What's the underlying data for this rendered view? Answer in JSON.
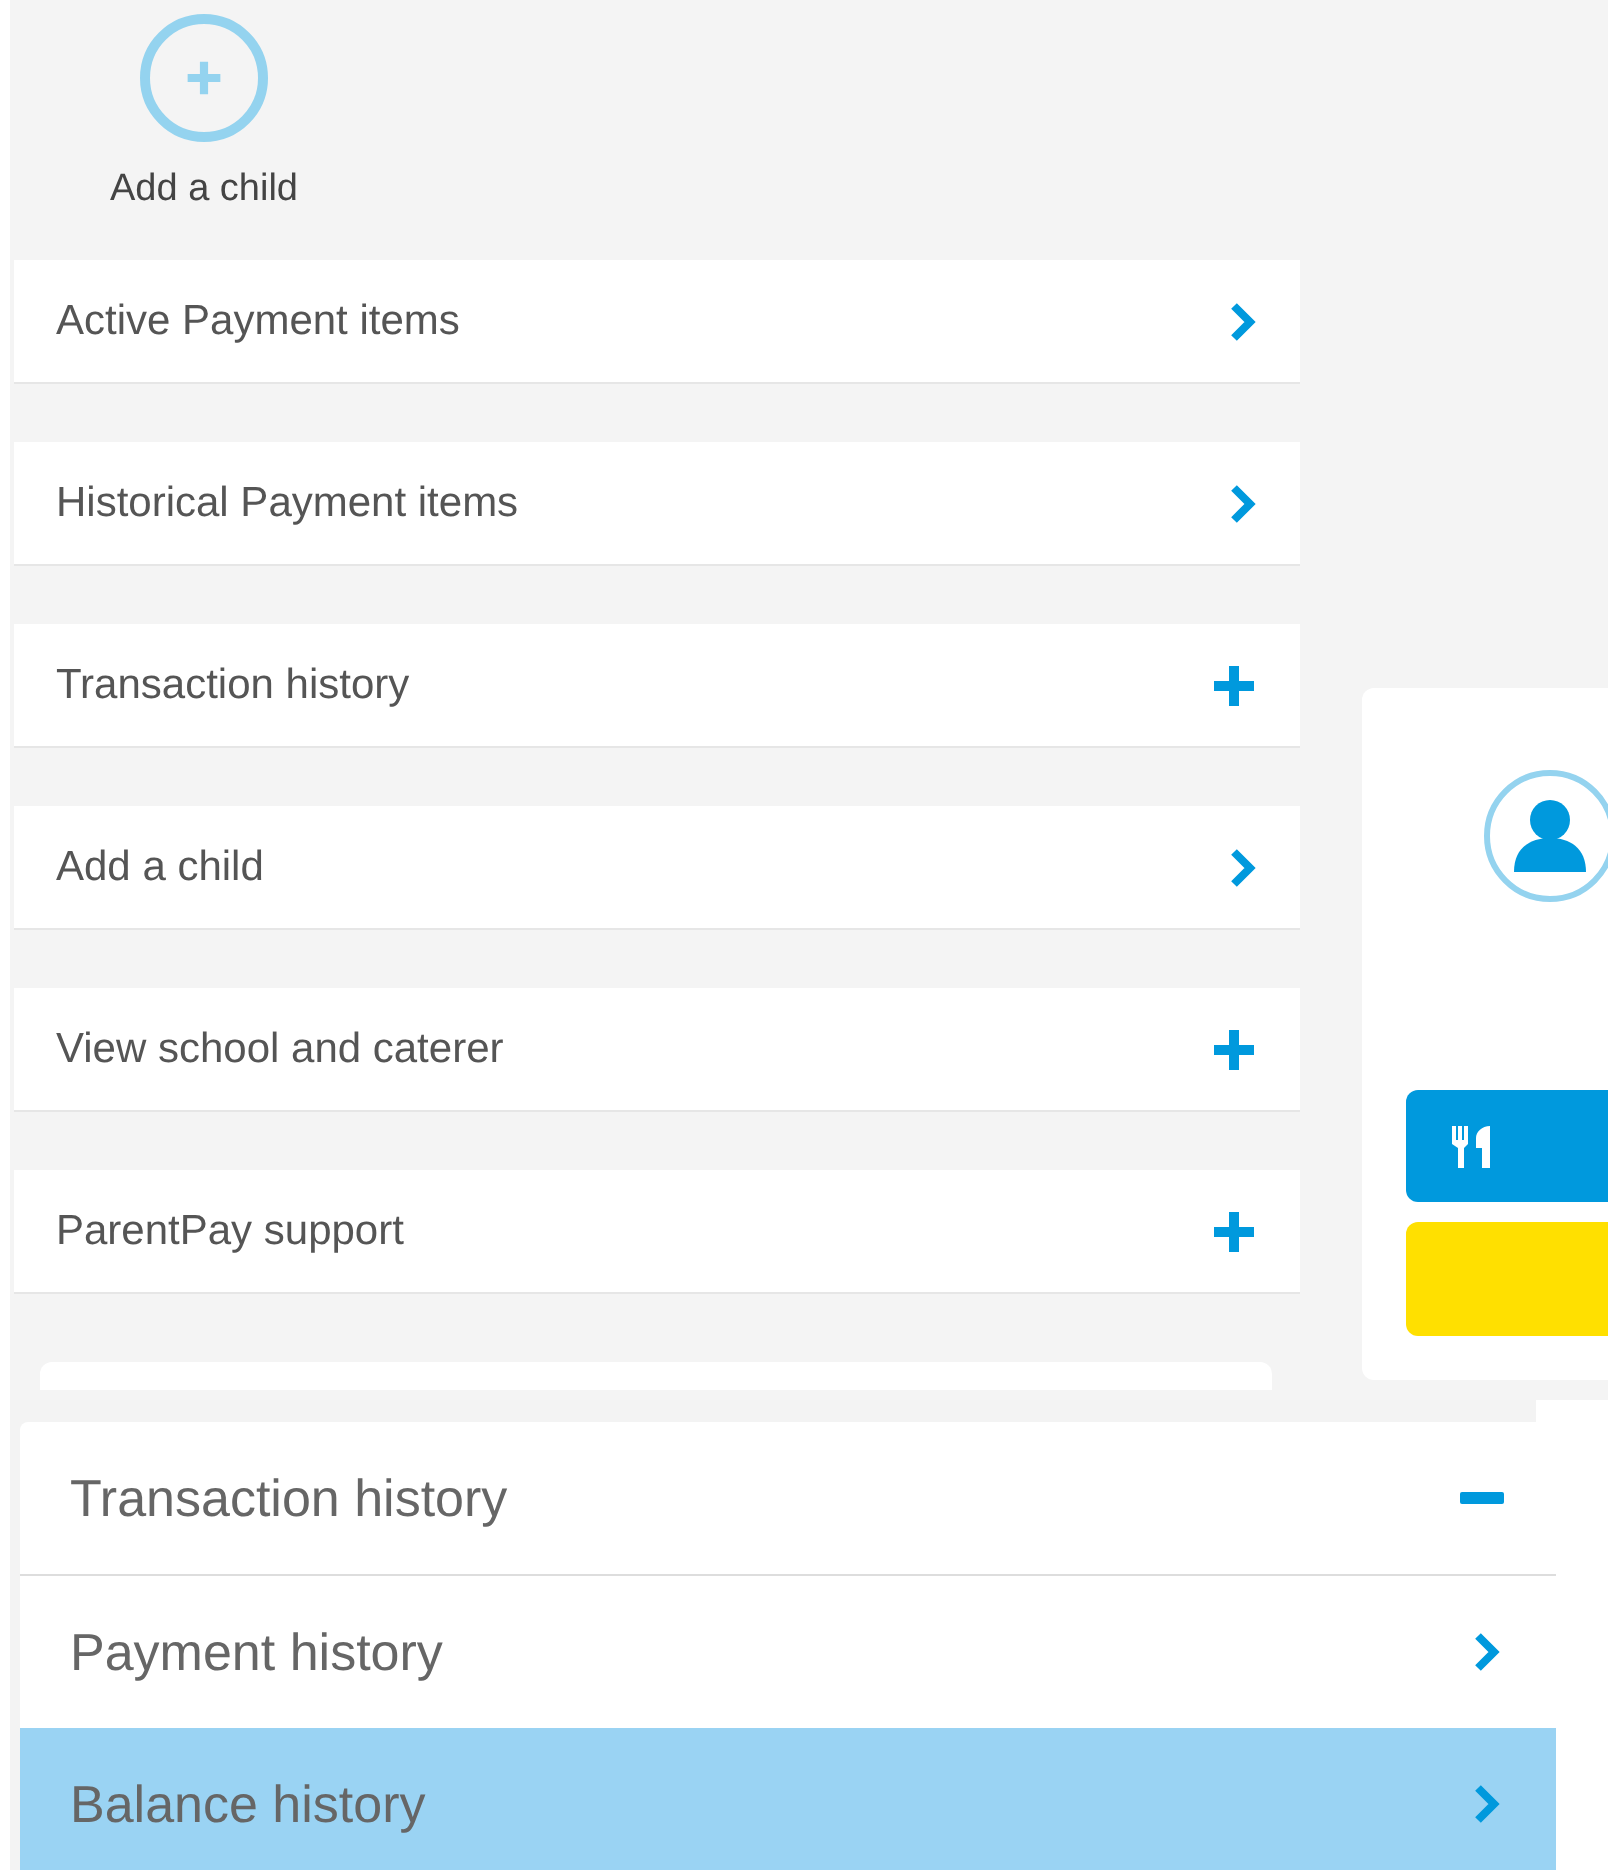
{
  "add_child": {
    "label": "Add a child"
  },
  "menu": [
    {
      "label": "Active Payment items",
      "kind": "link"
    },
    {
      "label": "Historical Payment items",
      "kind": "link"
    },
    {
      "label": "Transaction history",
      "kind": "expand"
    },
    {
      "label": "Add a child",
      "kind": "link"
    },
    {
      "label": "View school and caterer",
      "kind": "expand"
    },
    {
      "label": "ParentPay support",
      "kind": "expand"
    }
  ],
  "transaction_panel": {
    "title": "Transaction history",
    "expanded": true,
    "items": [
      {
        "label": "Payment history",
        "selected": false
      },
      {
        "label": "Balance history",
        "selected": true
      }
    ]
  }
}
